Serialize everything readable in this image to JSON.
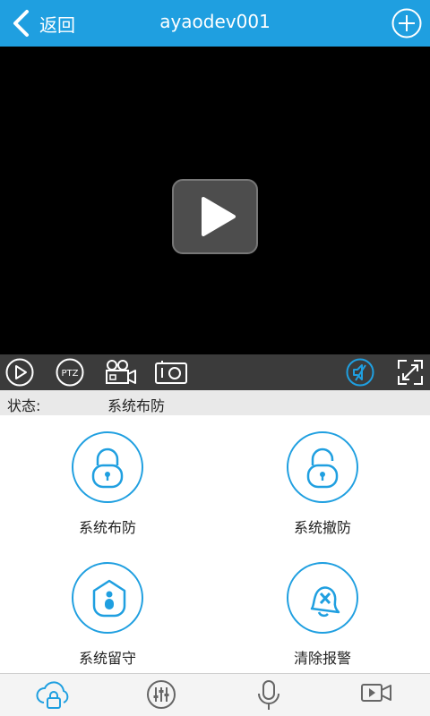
{
  "header": {
    "back_label": "返回",
    "title": "ayaodev001"
  },
  "status": {
    "label": "状态:",
    "value": "系统布防"
  },
  "actions": [
    {
      "label": "系统布防"
    },
    {
      "label": "系统撤防"
    },
    {
      "label": "系统留守"
    },
    {
      "label": "清除报警"
    }
  ],
  "colors": {
    "accent": "#1f9fe0",
    "video_bg": "#000000",
    "control_bar": "#3b3b3b"
  },
  "icons": {
    "back": "chevron-left-icon",
    "add": "plus-circle-icon",
    "play": "play-icon",
    "control_bar": [
      "play-circle-icon",
      "ptz-icon",
      "video-camera-icon",
      "snapshot-icon",
      "mute-icon",
      "fullscreen-icon"
    ],
    "tabs": [
      "cloud-lock-icon",
      "equalizer-icon",
      "microphone-icon",
      "video-record-icon"
    ]
  }
}
